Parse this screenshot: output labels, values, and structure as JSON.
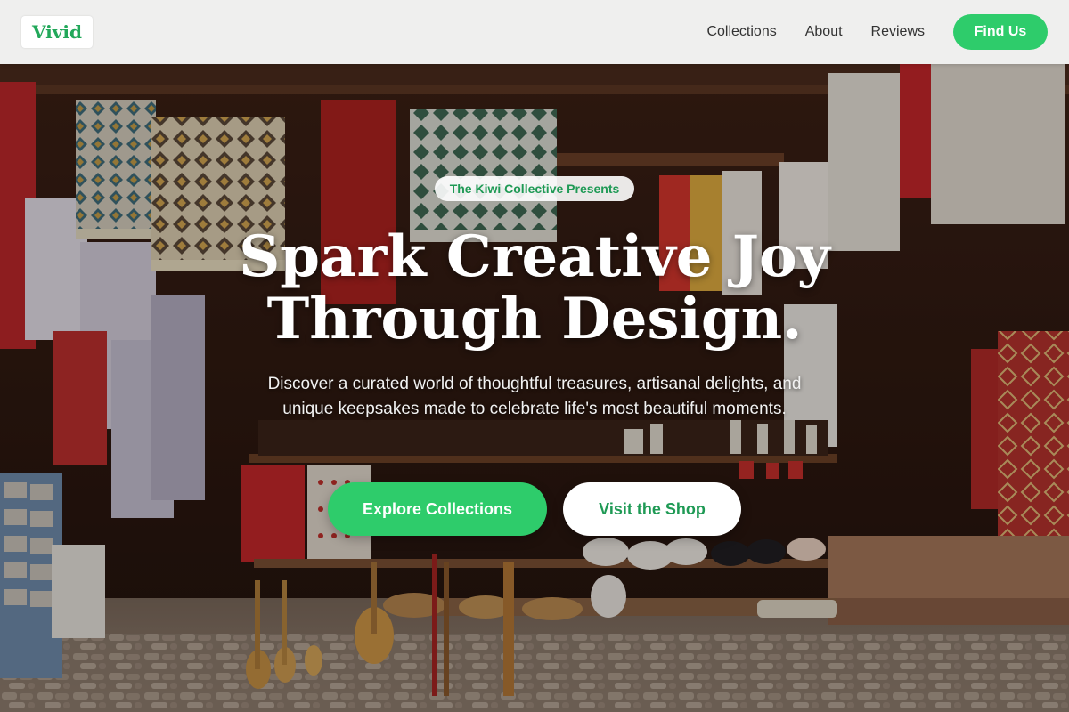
{
  "brand": {
    "logo_text": "Vivid",
    "accent": "#2ecc6b",
    "accent_dark": "#1f9a55"
  },
  "nav": {
    "links": [
      "Collections",
      "About",
      "Reviews"
    ],
    "cta_label": "Find Us"
  },
  "hero": {
    "badge": "The Kiwi Collective Presents",
    "headline_line1": "Spark Creative Joy",
    "headline_line2": "Through Design.",
    "subtitle": "Discover a curated world of thoughtful treasures, artisanal delights, and unique keepsakes made to celebrate life's most beautiful moments.",
    "primary_button": "Explore Collections",
    "secondary_button": "Visit the Shop",
    "background_description_icon": "photo-market-stall"
  }
}
